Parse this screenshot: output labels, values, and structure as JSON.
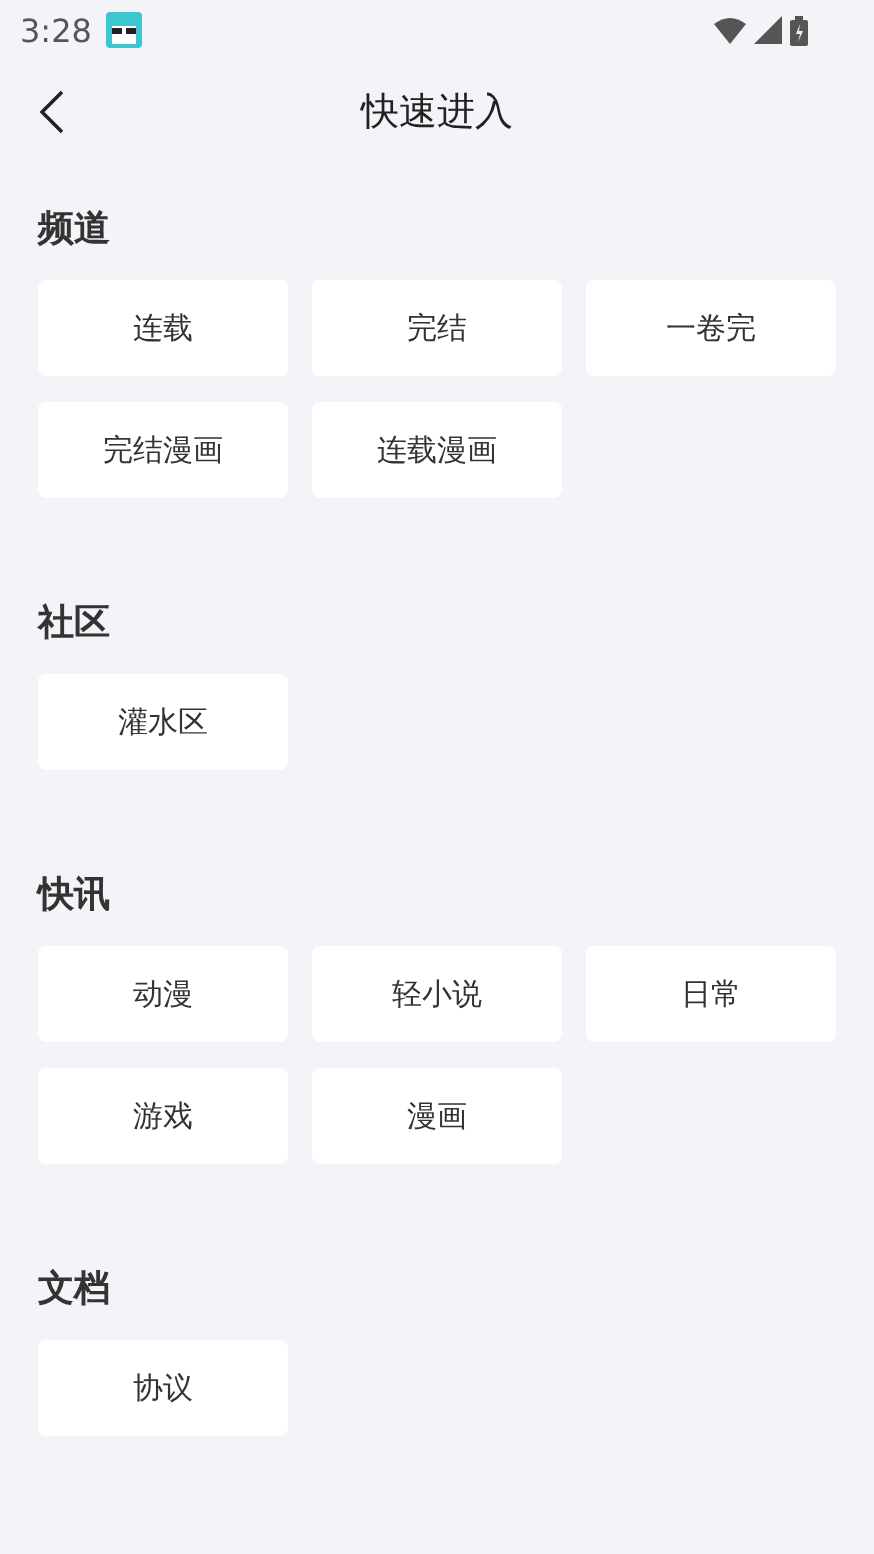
{
  "status_bar": {
    "time": "3:28"
  },
  "header": {
    "title": "快速进入"
  },
  "sections": [
    {
      "title": "频道",
      "items": [
        "连载",
        "完结",
        "一卷完",
        "完结漫画",
        "连载漫画"
      ]
    },
    {
      "title": "社区",
      "items": [
        "灌水区"
      ]
    },
    {
      "title": "快讯",
      "items": [
        "动漫",
        "轻小说",
        "日常",
        "游戏",
        "漫画"
      ]
    },
    {
      "title": "文档",
      "items": [
        "协议"
      ]
    }
  ]
}
